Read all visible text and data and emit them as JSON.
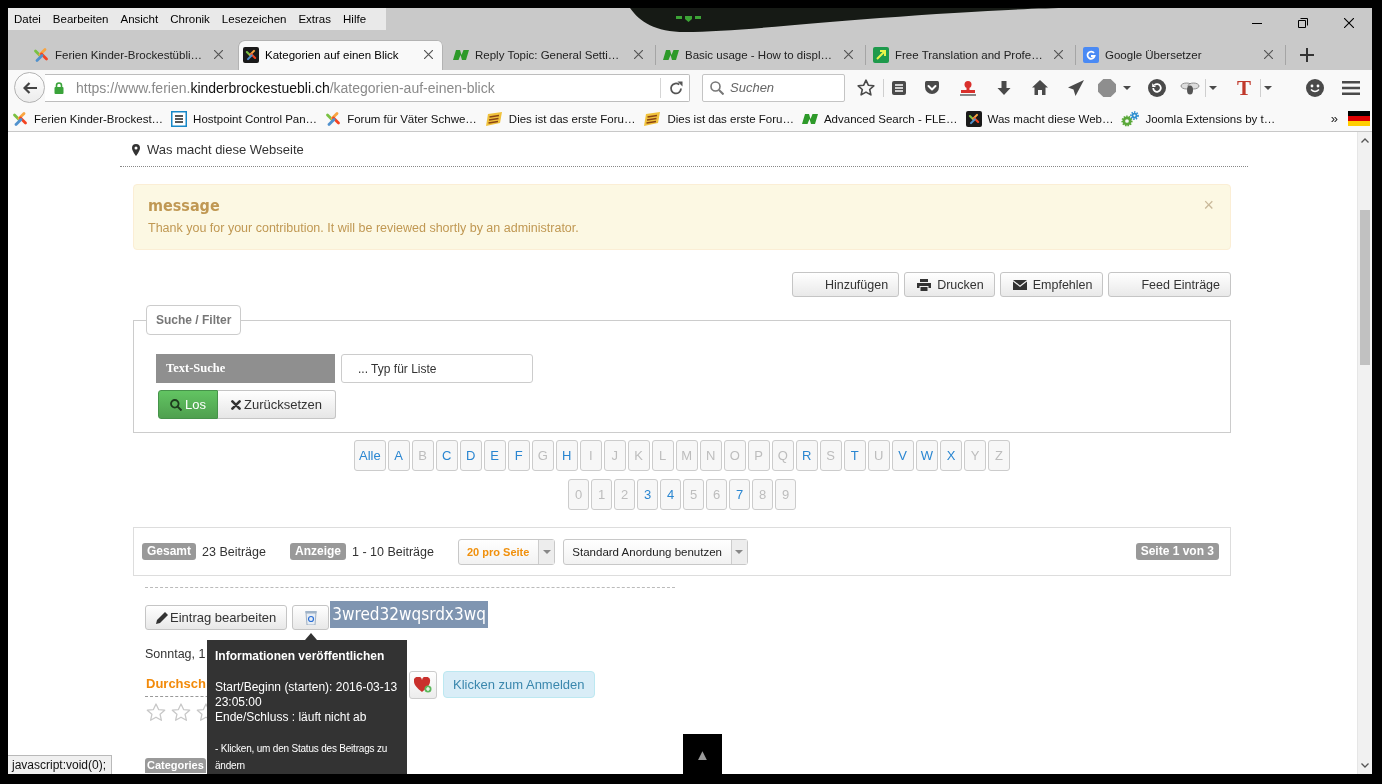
{
  "menu_bar": {
    "items": [
      "Datei",
      "Bearbeiten",
      "Ansicht",
      "Chronik",
      "Lesezeichen",
      "Extras",
      "Hilfe"
    ]
  },
  "tabs": [
    {
      "title": "Ferien Kinder-Brockestübli…",
      "kind": "pinwheel",
      "selected": false
    },
    {
      "title": "Kategorien auf einen Blick",
      "kind": "pinwheel-tile",
      "selected": true
    },
    {
      "title": "Reply Topic: General Setti…",
      "kind": "slanted",
      "selected": false
    },
    {
      "title": "Basic usage - How to displ…",
      "kind": "slanted",
      "selected": false
    },
    {
      "title": "Free Translation and Profe…",
      "kind": "arrow-tile",
      "selected": false
    },
    {
      "title": "Google Übersetzer",
      "kind": "translate",
      "selected": false
    }
  ],
  "nav_bar": {
    "url": {
      "prefix": "https://www.ferien.",
      "domain": "kinderbrockestuebli.ch",
      "path": "/kategorien-auf-einen-blick"
    },
    "search": {
      "placeholder": "Suchen"
    },
    "text_button": "T"
  },
  "bookmarks": {
    "items": [
      {
        "label": "Ferien Kinder-Brockest…",
        "kind": "pinwheel"
      },
      {
        "label": "Hostpoint Control Pan…",
        "kind": "list"
      },
      {
        "label": "Forum für Väter Schwe…",
        "kind": "pinwheel"
      },
      {
        "label": "Dies ist das erste Foru…",
        "kind": "banner"
      },
      {
        "label": "Dies ist das erste Foru…",
        "kind": "banner"
      },
      {
        "label": "Advanced Search - FLE…",
        "kind": "slanted"
      },
      {
        "label": "Was macht diese Web…",
        "kind": "pinwheel-tile"
      },
      {
        "label": "Joomla Extensions by t…",
        "kind": "gears"
      }
    ],
    "overflow": "»"
  },
  "page": {
    "breadcrumb": "Was macht diese Webseite",
    "alert": {
      "heading": "message",
      "text": "Thank you for your contribution. It will be reviewed shortly by an administrator.",
      "close": "×"
    },
    "actions": [
      {
        "label": "Hinzufügen",
        "kind": "blank"
      },
      {
        "label": "Drucken",
        "kind": "print"
      },
      {
        "label": "Empfehlen",
        "kind": "mail"
      },
      {
        "label": "Feed Einträge",
        "kind": "blank"
      }
    ],
    "filter": {
      "legend": "Suche / Filter",
      "label": "Text-Suche",
      "placeholder": "... Typ für Liste",
      "search_button": "Los",
      "reset_button": "Zurücksetzen"
    },
    "letters": [
      {
        "label": "Alle",
        "disabled": false
      },
      {
        "label": "A",
        "disabled": false
      },
      {
        "label": "B",
        "disabled": true
      },
      {
        "label": "C",
        "disabled": false
      },
      {
        "label": "D",
        "disabled": false
      },
      {
        "label": "E",
        "disabled": false
      },
      {
        "label": "F",
        "disabled": false
      },
      {
        "label": "G",
        "disabled": true
      },
      {
        "label": "H",
        "disabled": false
      },
      {
        "label": "I",
        "disabled": true
      },
      {
        "label": "J",
        "disabled": true
      },
      {
        "label": "K",
        "disabled": true
      },
      {
        "label": "L",
        "disabled": true
      },
      {
        "label": "M",
        "disabled": true
      },
      {
        "label": "N",
        "disabled": true
      },
      {
        "label": "O",
        "disabled": true
      },
      {
        "label": "P",
        "disabled": true
      },
      {
        "label": "Q",
        "disabled": true
      },
      {
        "label": "R",
        "disabled": false
      },
      {
        "label": "S",
        "disabled": true
      },
      {
        "label": "T",
        "disabled": false
      },
      {
        "label": "U",
        "disabled": true
      },
      {
        "label": "V",
        "disabled": false
      },
      {
        "label": "W",
        "disabled": false
      },
      {
        "label": "X",
        "disabled": false
      },
      {
        "label": "Y",
        "disabled": true
      },
      {
        "label": "Z",
        "disabled": true
      }
    ],
    "digits": [
      {
        "label": "0",
        "disabled": true
      },
      {
        "label": "1",
        "disabled": true
      },
      {
        "label": "2",
        "disabled": true
      },
      {
        "label": "3",
        "disabled": false
      },
      {
        "label": "4",
        "disabled": false
      },
      {
        "label": "5",
        "disabled": true
      },
      {
        "label": "6",
        "disabled": true
      },
      {
        "label": "7",
        "disabled": false
      },
      {
        "label": "8",
        "disabled": true
      },
      {
        "label": "9",
        "disabled": true
      }
    ],
    "summary": {
      "total": {
        "label": "Gesamt",
        "value": "23 Beiträge"
      },
      "shown": {
        "label": "Anzeige",
        "value": "1 - 10 Beiträge"
      },
      "per_page": "20 pro Seite",
      "ordering": "Standard Anordung benutzen",
      "page_info": "Seite 1 von 3"
    },
    "entry": {
      "edit_button": "Eintrag bearbeiten",
      "title": {
        "text": "3wred32wqsrdx3wq",
        "highlighted": true
      },
      "date": "Sonntag, 1",
      "rating": {
        "label": "Durchsch",
        "stars": 0
      },
      "login_button": "Klicken zum Anmelden",
      "category_label": "Categories"
    },
    "tooltip": {
      "title": "Informationen veröffentlichen",
      "lines": [
        "Start/Beginn (starten): 2016-03-13 23:05:00",
        "Ende/Schluss : läuft nicht ab"
      ],
      "note": "- Klicken, um den Status des Beitrags zu ändern"
    },
    "back_to_top": "▲"
  },
  "status_bar": {
    "text": "javascript:void(0);"
  }
}
